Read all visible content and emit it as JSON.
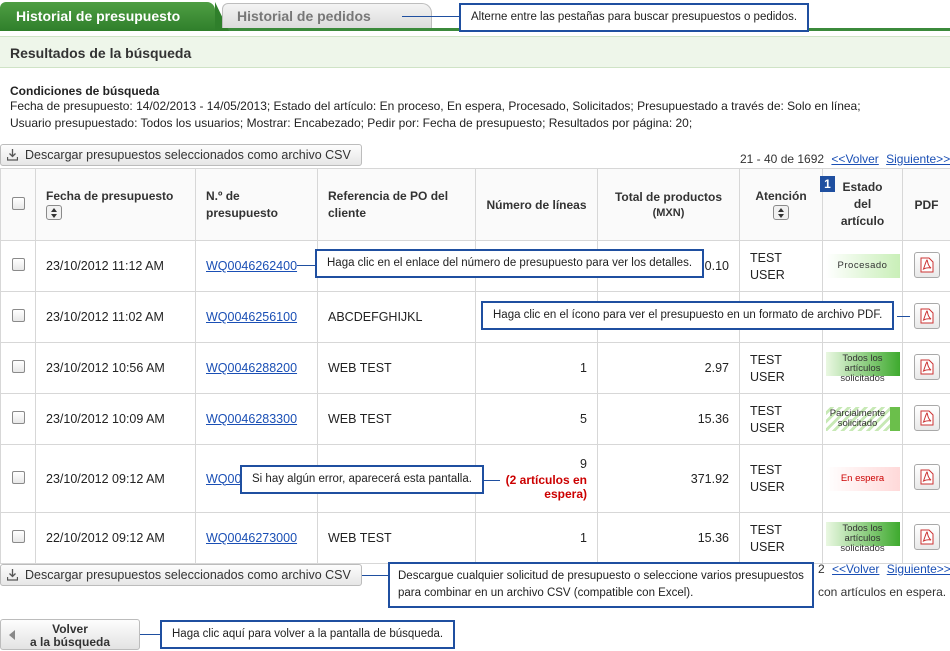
{
  "tabs": {
    "active": "Historial de presupuesto",
    "inactive": "Historial de pedidos"
  },
  "results_title": "Resultados de la búsqueda",
  "conditions": {
    "title": "Condiciones de búsqueda",
    "line1": "Fecha de presupuesto: 14/02/2013 - 14/05/2013;   Estado del artículo: En proceso, En espera, Procesado, Solicitados;   Presupuestado a través de: Solo en línea;",
    "line2": "Usuario presupuestado: Todos los usuarios;   Mostrar: Encabezado;   Pedir por: Fecha de presupuesto;   Resultados por página: 20;"
  },
  "download_label": "Descargar presupuestos seleccionados como archivo CSV",
  "pager": {
    "range": "21 - 40 de 1692",
    "prev": "<<Volver",
    "next": "Siguiente>>",
    "bottom_range_tail": "2"
  },
  "table": {
    "headers": {
      "date": "Fecha de presupuesto",
      "quote_no_1": "N.º de",
      "quote_no_2": "presupuesto",
      "po_ref_1": "Referencia de PO del",
      "po_ref_2": "cliente",
      "lines": "Número de líneas",
      "total_1": "Total de productos",
      "total_2": "(MXN)",
      "attention": "Atención",
      "status_1": "Estado",
      "status_2": "del",
      "status_3": "artículo",
      "pdf": "PDF"
    },
    "rows": [
      {
        "date": "23/10/2012 11:12 AM",
        "quote": "WQ0046262400",
        "po": "",
        "lines": "",
        "hold": "",
        "total": "0.10",
        "att1": "TEST",
        "att2": "USER",
        "status": "Procesado"
      },
      {
        "date": "23/10/2012 11:02 AM",
        "quote": "WQ0046256100",
        "po": "ABCDEFGHIJKL",
        "lines": "",
        "hold": "",
        "total": "",
        "att1": "",
        "att2": "",
        "status": ""
      },
      {
        "date": "23/10/2012 10:56 AM",
        "quote": "WQ0046288200",
        "po": "WEB TEST",
        "lines": "1",
        "hold": "",
        "total": "2.97",
        "att1": "TEST",
        "att2": "USER",
        "status": "Todos los artículos solicitados"
      },
      {
        "date": "23/10/2012 10:09 AM",
        "quote": "WQ0046283300",
        "po": "WEB TEST",
        "lines": "5",
        "hold": "",
        "total": "15.36",
        "att1": "TEST",
        "att2": "USER",
        "status": "Parcialmente solicitado"
      },
      {
        "date": "23/10/2012 09:12 AM",
        "quote": "WQ00",
        "po": "",
        "lines": "9",
        "hold": "(2 artículos en espera)",
        "total": "371.92",
        "att1": "TEST",
        "att2": "USER",
        "status": "En espera"
      },
      {
        "date": "22/10/2012 09:12 AM",
        "quote": "WQ0046273000",
        "po": "WEB TEST",
        "lines": "1",
        "hold": "",
        "total": "15.36",
        "att1": "TEST",
        "att2": "USER",
        "status": "Todos los artículos solicitados"
      }
    ]
  },
  "callouts": {
    "tabs": "Alterne entre las pestañas para buscar presupuestos o pedidos.",
    "quote_link": "Haga clic en el enlace del número de presupuesto para ver los detalles.",
    "pdf": "Haga clic en el ícono para ver el presupuesto en un formato de archivo PDF.",
    "error": "Si hay algún error, aparecerá esta pantalla.",
    "csv_1": "Descargue cualquier solicitud de presupuesto o seleccione varios presupuestos",
    "csv_2": "para combinar en un archivo CSV (compatible con Excel).",
    "back": "Haga clic aquí para volver a la pantalla de búsqueda."
  },
  "badge_number": "1",
  "hold_note_tail": "con artículos en espera.",
  "back_button": {
    "line1": "Volver",
    "line2": "a la búsqueda"
  },
  "colors": {
    "tab_green": "#2f7f2b",
    "link_blue": "#1a4fb5",
    "callout_border": "#1f4fa0",
    "hold_red": "#cc0000"
  }
}
